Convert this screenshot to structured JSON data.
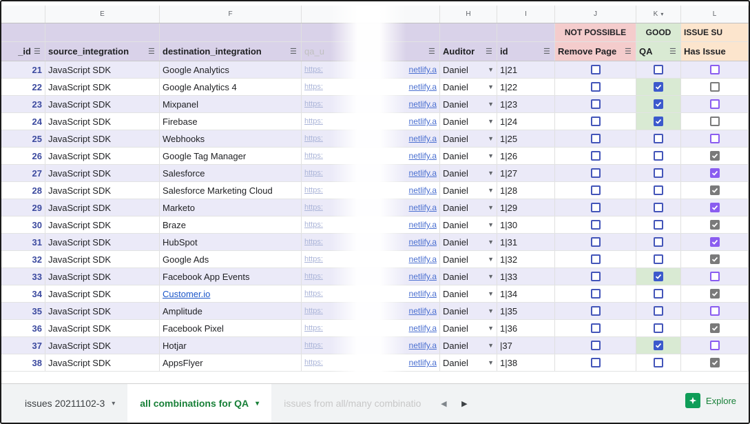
{
  "columns": {
    "letters": [
      "",
      "E",
      "F",
      "",
      "H",
      "I",
      "J",
      "K",
      "L"
    ]
  },
  "category_row": {
    "j": "NOT POSSIBLE",
    "k": "GOOD",
    "l": "ISSUE SU"
  },
  "headers": {
    "id": "_id",
    "source": "source_integration",
    "destination": "destination_integration",
    "url": "qa_u",
    "auditor": "Auditor",
    "i": "id",
    "j": "Remove Page",
    "k": "QA",
    "l": "Has Issue"
  },
  "rows": [
    {
      "id": "21",
      "source": "JavaScript SDK",
      "destination": "Google Analytics",
      "url_a": "https:",
      "url_b": "netlify.a",
      "auditor": "Daniel",
      "i": "1|21",
      "remove": false,
      "qa": false,
      "issue": false,
      "issue_style": "purple"
    },
    {
      "id": "22",
      "source": "JavaScript SDK",
      "destination": "Google Analytics 4",
      "url_a": "https:",
      "url_b": "netlify.a",
      "auditor": "Daniel",
      "i": "1|22",
      "remove": false,
      "qa": true,
      "issue": false,
      "issue_style": "gray"
    },
    {
      "id": "23",
      "source": "JavaScript SDK",
      "destination": "Mixpanel",
      "url_a": "https:",
      "url_b": "netlify.a",
      "auditor": "Daniel",
      "i": "1|23",
      "remove": false,
      "qa": true,
      "issue": false,
      "issue_style": "purple"
    },
    {
      "id": "24",
      "source": "JavaScript SDK",
      "destination": "Firebase",
      "url_a": "https:",
      "url_b": "netlify.a",
      "auditor": "Daniel",
      "i": "1|24",
      "remove": false,
      "qa": true,
      "issue": false,
      "issue_style": "gray"
    },
    {
      "id": "25",
      "source": "JavaScript SDK",
      "destination": "Webhooks",
      "url_a": "https:",
      "url_b": "netlify.a",
      "auditor": "Daniel",
      "i": "1|25",
      "remove": false,
      "qa": false,
      "issue": false,
      "issue_style": "purple"
    },
    {
      "id": "26",
      "source": "JavaScript SDK",
      "destination": "Google Tag Manager",
      "url_a": "https:",
      "url_b": "netlify.a",
      "auditor": "Daniel",
      "i": "1|26",
      "remove": false,
      "qa": false,
      "issue": true,
      "issue_style": "gray"
    },
    {
      "id": "27",
      "source": "JavaScript SDK",
      "destination": "Salesforce",
      "url_a": "https:",
      "url_b": "netlify.a",
      "auditor": "Daniel",
      "i": "1|27",
      "remove": false,
      "qa": false,
      "issue": true,
      "issue_style": "purple"
    },
    {
      "id": "28",
      "source": "JavaScript SDK",
      "destination": "Salesforce Marketing Cloud",
      "url_a": "https:",
      "url_b": "netlify.a",
      "auditor": "Daniel",
      "i": "1|28",
      "remove": false,
      "qa": false,
      "issue": true,
      "issue_style": "gray"
    },
    {
      "id": "29",
      "source": "JavaScript SDK",
      "destination": "Marketo",
      "url_a": "https:",
      "url_b": "netlify.a",
      "auditor": "Daniel",
      "i": "1|29",
      "remove": false,
      "qa": false,
      "issue": true,
      "issue_style": "purple"
    },
    {
      "id": "30",
      "source": "JavaScript SDK",
      "destination": "Braze",
      "url_a": "https:",
      "url_b": "netlify.a",
      "auditor": "Daniel",
      "i": "1|30",
      "remove": false,
      "qa": false,
      "issue": true,
      "issue_style": "gray"
    },
    {
      "id": "31",
      "source": "JavaScript SDK",
      "destination": "HubSpot",
      "url_a": "https:",
      "url_b": "netlify.a",
      "auditor": "Daniel",
      "i": "1|31",
      "remove": false,
      "qa": false,
      "issue": true,
      "issue_style": "purple"
    },
    {
      "id": "32",
      "source": "JavaScript SDK",
      "destination": "Google Ads",
      "url_a": "https:",
      "url_b": "netlify.a",
      "auditor": "Daniel",
      "i": "1|32",
      "remove": false,
      "qa": false,
      "issue": true,
      "issue_style": "gray"
    },
    {
      "id": "33",
      "source": "JavaScript SDK",
      "destination": "Facebook App Events",
      "url_a": "https:",
      "url_b": "netlify.a",
      "auditor": "Daniel",
      "i": "1|33",
      "remove": false,
      "qa": true,
      "issue": false,
      "issue_style": "purple"
    },
    {
      "id": "34",
      "source": "JavaScript SDK",
      "destination": "Customer.io",
      "destination_link": true,
      "url_a": "https:",
      "url_b": "netlify.a",
      "auditor": "Daniel",
      "i": "1|34",
      "remove": false,
      "qa": false,
      "issue": true,
      "issue_style": "gray"
    },
    {
      "id": "35",
      "source": "JavaScript SDK",
      "destination": "Amplitude",
      "url_a": "https:",
      "url_b": "netlify.a",
      "auditor": "Daniel",
      "i": "1|35",
      "remove": false,
      "qa": false,
      "issue": false,
      "issue_style": "purple"
    },
    {
      "id": "36",
      "source": "JavaScript SDK",
      "destination": "Facebook Pixel",
      "url_a": "https:",
      "url_b": "netlify.a",
      "auditor": "Daniel",
      "i": "1|36",
      "remove": false,
      "qa": false,
      "issue": true,
      "issue_style": "gray"
    },
    {
      "id": "37",
      "source": "JavaScript SDK",
      "destination": "Hotjar",
      "url_a": "https:",
      "url_b": "netlify.a",
      "auditor": "Daniel",
      "i": "|37",
      "remove": false,
      "qa": true,
      "issue": false,
      "issue_style": "purple"
    },
    {
      "id": "38",
      "source": "JavaScript SDK",
      "destination": "AppsFlyer",
      "url_a": "https:",
      "url_b": "netlify.a",
      "auditor": "Daniel",
      "i": "1|38",
      "remove": false,
      "qa": false,
      "issue": true,
      "issue_style": "gray"
    }
  ],
  "tabs": [
    {
      "label": "issues 20211102-3",
      "active": false,
      "faded": false
    },
    {
      "label": "all combinations for QA",
      "active": true,
      "faded": false
    },
    {
      "label": "issues from all/many combinatio",
      "active": false,
      "faded": true
    }
  ],
  "explore_label": "Explore",
  "colors": {
    "header_bg": "#d9d2e9",
    "row_alt": "#ebeaf8",
    "not_possible": "#f4cccc",
    "good": "#d9ead3",
    "issue": "#fce5cd",
    "accent_green": "#188038",
    "checkbox_blue": "#3c59cc"
  }
}
